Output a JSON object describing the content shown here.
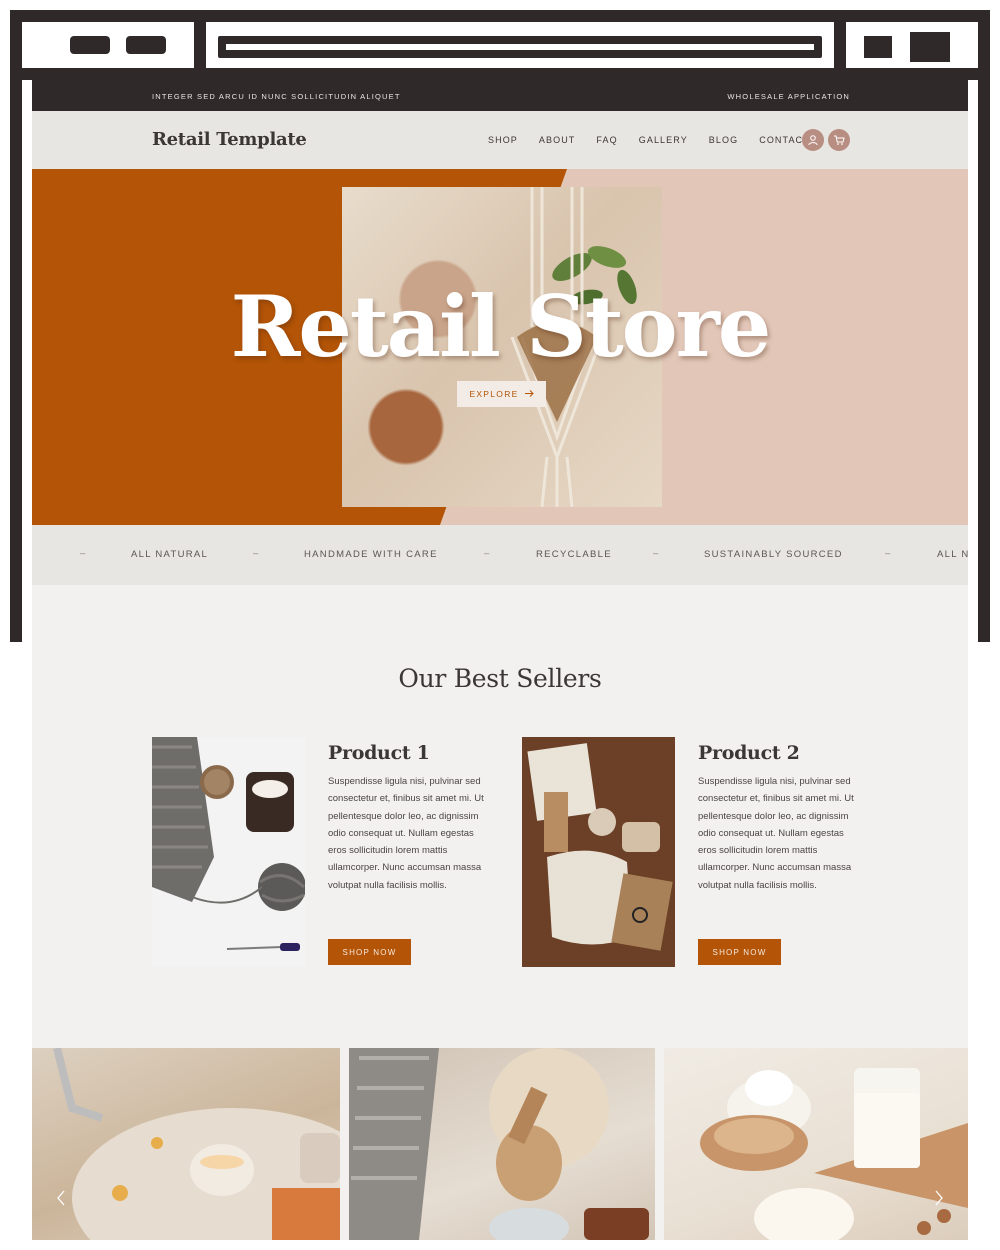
{
  "site": {
    "topbar": {
      "promo": "INTEGER SED ARCU ID NUNC SOLLICITUDIN ALIQUET",
      "wholesale": "WHOLESALE APPLICATION"
    },
    "brand": "Retail Template",
    "nav": [
      "SHOP",
      "ABOUT",
      "FAQ",
      "GALLERY",
      "BLOG",
      "CONTACT"
    ],
    "icons": {
      "account": "user-icon",
      "cart": "cart-icon"
    },
    "hero": {
      "title": "Retail Store",
      "cta": "EXPLORE",
      "cta_icon": "arrow-right-icon"
    },
    "ticker": [
      "ALL NATURAL",
      "HANDMADE WITH CARE",
      "RECYCLABLE",
      "SUSTAINABLY SOURCED",
      "ALL N"
    ],
    "ticker_separator": "–",
    "best_sellers": {
      "title": "Our Best Sellers",
      "products": [
        {
          "name": "Product 1",
          "description": "Suspendisse ligula nisi, pulvinar sed consectetur et, finibus sit amet mi. Ut pellentesque dolor leo, ac dignissim odio consequat ut. Nullam egestas eros sollicitudin lorem mattis ullamcorper. Nunc accumsan massa volutpat nulla facilisis mollis.",
          "cta": "SHOP NOW"
        },
        {
          "name": "Product 2",
          "description": "Suspendisse ligula nisi, pulvinar sed consectetur et, finibus sit amet mi. Ut pellentesque dolor leo, ac dignissim odio consequat ut. Nullam egestas eros sollicitudin lorem mattis ullamcorper. Nunc accumsan massa volutpat nulla facilisis mollis.",
          "cta": "SHOP NOW"
        }
      ]
    },
    "carousel": {
      "prev_icon": "chevron-left-icon",
      "next_icon": "chevron-right-icon"
    }
  },
  "colors": {
    "rust": "#b35406",
    "blush": "#e2c7b8",
    "dark": "#2f2a29",
    "header_bg": "#e8e6e2",
    "page_bg": "#f2f1f0",
    "icon_mauve": "#b88d82"
  }
}
